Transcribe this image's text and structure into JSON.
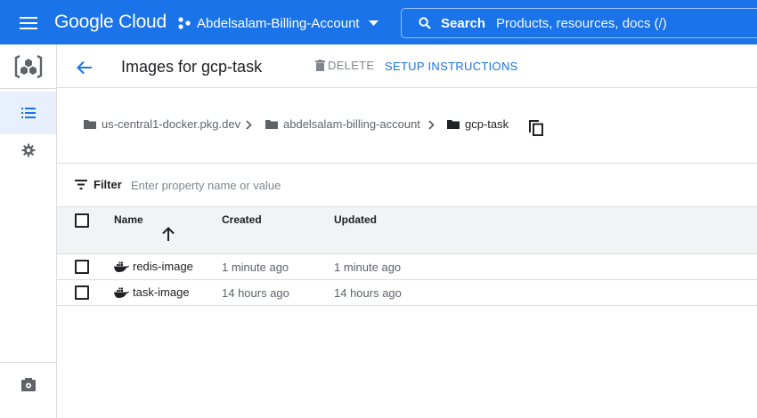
{
  "topbar": {
    "logo": "Google Cloud",
    "project_name": "Abdelsalam-Billing-Account",
    "search_label": "Search",
    "search_placeholder": "Products, resources, docs (/)"
  },
  "header": {
    "title": "Images for gcp-task",
    "delete_label": "DELETE",
    "setup_label": "SETUP INSTRUCTIONS"
  },
  "breadcrumb": [
    {
      "label": "us-central1-docker.pkg.dev"
    },
    {
      "label": "abdelsalam-billing-account"
    },
    {
      "label": "gcp-task"
    }
  ],
  "filter": {
    "label": "Filter",
    "placeholder": "Enter property name or value"
  },
  "table": {
    "columns": [
      "Name",
      "Created",
      "Updated"
    ],
    "rows": [
      {
        "name": "redis-image",
        "created": "1 minute ago",
        "updated": "1 minute ago"
      },
      {
        "name": "task-image",
        "created": "14 hours ago",
        "updated": "14 hours ago"
      }
    ]
  },
  "icons": {
    "menu": "hamburger-menu-icon",
    "project": "project-hierarchy-icon",
    "search": "search-icon",
    "product": "artifact-registry-icon",
    "list": "list-icon",
    "settings": "gear-icon",
    "back": "arrow-left-icon",
    "delete": "trash-icon",
    "folder": "folder-icon",
    "copy": "copy-icon",
    "filter": "filter-icon",
    "sort": "arrow-up-icon",
    "docker": "docker-icon"
  },
  "colors": {
    "brand_blue": "#1a73e8",
    "active_nav_bg": "#e8f0fe",
    "header_row_bg": "#f1f3f4"
  }
}
